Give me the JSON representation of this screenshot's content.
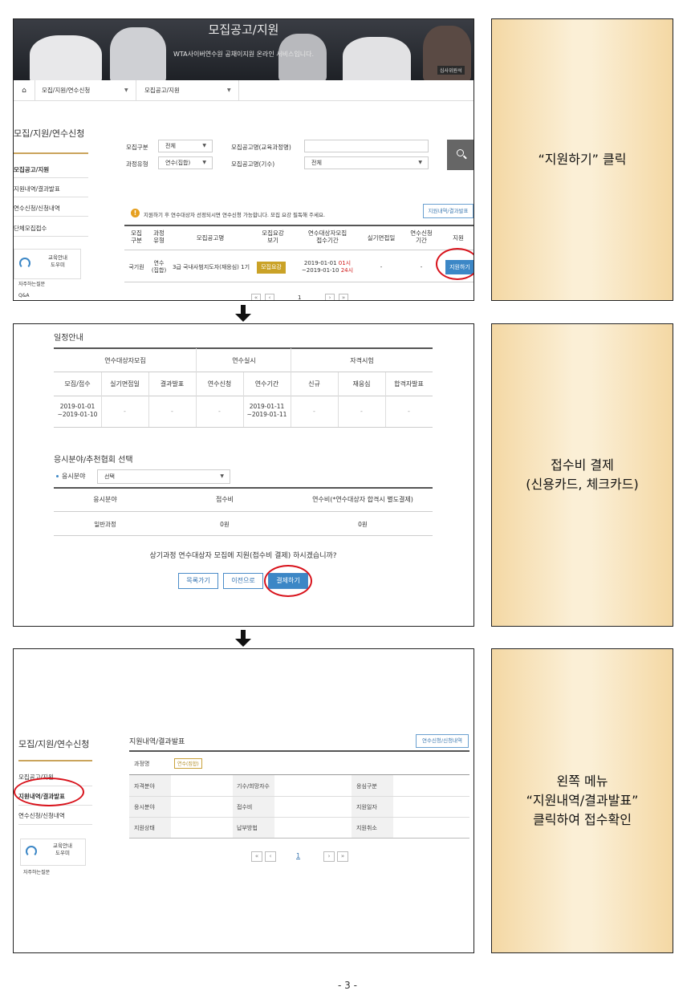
{
  "panel1": {
    "banner_title": "모집공고/지원",
    "banner_subtitle": "WTA사이버연수원 공채이지원 온라인 서비스입니다.",
    "banner_name_card": "심사위원석",
    "breadcrumb": {
      "level1": "모집/지원/연수신청",
      "level2": "모집공고/지원"
    },
    "sidebar": {
      "heading": "모집/지원/연수신청",
      "items": [
        "모집공고/지원",
        "지원내역/결과발표",
        "연수신청/신청내역",
        "단체모집접수"
      ],
      "help_label": "교육안내\n도우미",
      "faq": "자주하는질문",
      "qa": "Q&A"
    },
    "search": {
      "recruit_type_label": "모집구분",
      "recruit_type_value": "전체",
      "course_type_label": "과정유형",
      "course_type_value": "연수(집합)",
      "notice_name_label": "모집공고명(교육과정명)",
      "notice_name_value": "",
      "notice_term_label": "모집공고명(기수)",
      "notice_term_value": "전체"
    },
    "notice": "지원하기 후 연수대상자 선정되시면 연수신청 가능합니다. 모집 요강 필독해 주세요.",
    "history_button": "지원내역/결과발표",
    "table": {
      "headers": [
        "모집\n구분",
        "과정\n유형",
        "모집공고명",
        "모집요강\n보기",
        "연수대상자모집\n접수기간",
        "실기면접일",
        "연수신청\n기간",
        "지원"
      ],
      "row": {
        "recruit": "국기원",
        "course_type": "연수\n(집합)",
        "name": "3급 국내사범지도자(재응심) 1기",
        "guide_button": "모집요강",
        "period_start": "2019-01-01 ",
        "period_start_time": "01시",
        "period_end": "~2019-01-10 ",
        "period_end_time": "24시",
        "interview": "-",
        "apply_period": "-",
        "apply_button": "지원하기"
      }
    },
    "pager": {
      "first": "«",
      "prev": "‹",
      "page": "1",
      "next": "›",
      "last": "»"
    }
  },
  "panel2": {
    "schedule_title": "일정안내",
    "groups": [
      "연수대상자모집",
      "연수실시",
      "자격시험"
    ],
    "headers": [
      "모집/접수",
      "실기면접일",
      "결과발표",
      "연수신청",
      "연수기간",
      "신규",
      "재응심",
      "합격자발표"
    ],
    "cells": [
      "2019-01-01\n~2019-01-10",
      "-",
      "-",
      "-",
      "2019-01-11\n~2019-01-11",
      "-",
      "-",
      "-"
    ],
    "field_title": "응시분야/추천협회 선택",
    "field_label": "응시분야",
    "field_select": "선택",
    "fee_headers": [
      "응시분야",
      "접수비",
      "연수비(*연수대상자 합격시 별도결제)"
    ],
    "fee_row": [
      "일반과정",
      "0원",
      "0원"
    ],
    "confirm_question": "상기과정 연수대상자 모집에 지원(접수비 결제) 하시겠습니까?",
    "buttons": {
      "list": "목록가기",
      "prev": "이전으로",
      "pay": "결제하기"
    }
  },
  "panel3": {
    "sidebar_heading": "모집/지원/연수신청",
    "sidebar_items": [
      "모집공고/지원",
      "지원내역/결과발표",
      "연수신청/신청내역"
    ],
    "help_label": "교육안내\n도우미",
    "faq": "자주하는질문",
    "section_title": "지원내역/결과발표",
    "top_button": "연수신청/신청내역",
    "course_label": "과정명",
    "course_tag": "연수(집합)",
    "rows": [
      [
        "자격분야",
        "",
        "기수/희망자수",
        "",
        "응심구분",
        ""
      ],
      [
        "응시분야",
        "",
        "접수비",
        "",
        "지원일자",
        ""
      ],
      [
        "지원상태",
        "",
        "납부방법",
        "",
        "지원취소",
        ""
      ]
    ],
    "pager": {
      "first": "«",
      "prev": "‹",
      "page": "1",
      "next": "›",
      "last": "»"
    }
  },
  "captions": [
    "“지원하기” 클릭",
    "접수비 결제\n(신용카드, 체크카드)",
    "왼쪽 메뉴\n“지원내역/결과발표”\n클릭하여 접수확인"
  ],
  "page_number": "- 3 -"
}
